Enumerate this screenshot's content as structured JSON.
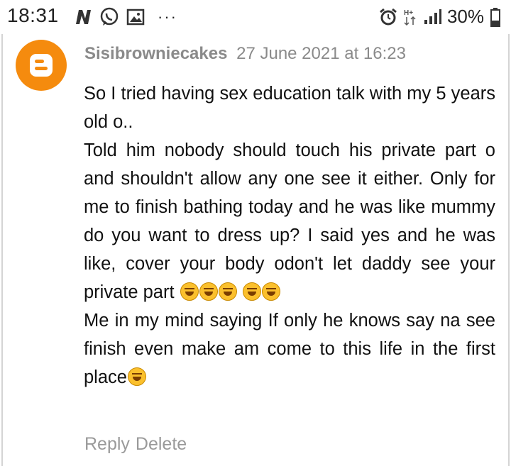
{
  "status_bar": {
    "time": "18:31",
    "battery": "30%",
    "left_icons": [
      "n-icon",
      "whatsapp-icon",
      "gallery-icon",
      "more-icon"
    ],
    "right_icons": [
      "alarm-icon",
      "data-hplus-icon",
      "signal-icon",
      "battery-icon"
    ],
    "overflow": "···"
  },
  "comment": {
    "author": "Sisibrowniecakes",
    "timestamp": "27 June 2021 at 16:23",
    "avatar": "blogger-logo-icon",
    "paragraphs": [
      "So I tried having sex education talk with my 5 years old o..",
      "Told him nobody should touch his private part o and shouldn't allow any one see it either. Only for me to finish bathing today and he was like mummy do you want to dress up? I said yes and he was like, cover your body odon't let daddy see your private part",
      "Me in my mind saying If only he knows say na see finish even make am come to this life in the first place"
    ],
    "reply_label": "Reply",
    "delete_label": "Delete"
  },
  "colors": {
    "avatar_bg": "#f58b0e",
    "meta_text": "#8a8a8a",
    "body_text": "#111111",
    "action_text": "#9a9a9a"
  }
}
